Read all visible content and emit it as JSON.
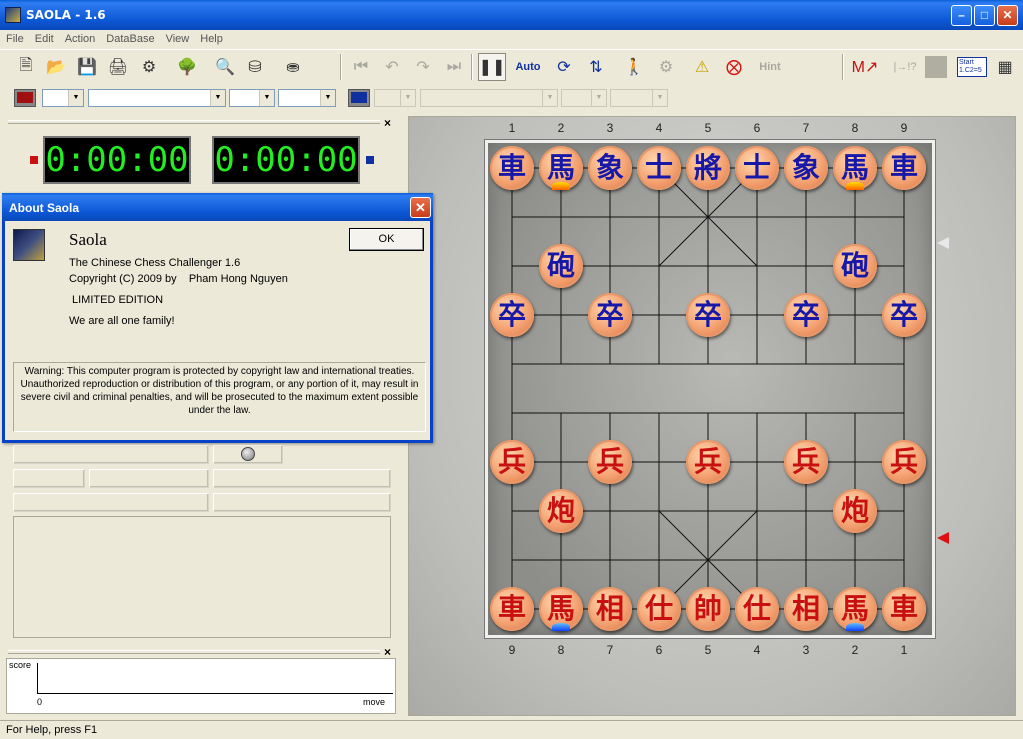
{
  "window": {
    "title": "SAOLA - 1.6"
  },
  "menu": [
    "File",
    "Edit",
    "Action",
    "DataBase",
    "View",
    "Help"
  ],
  "toolbar": {
    "auto_label": "Auto",
    "hint_label": "Hint",
    "start_label": "Start 1.C2=5"
  },
  "clocks": {
    "left": "0:00:00",
    "right": "0:00:00"
  },
  "graph": {
    "y_label": "score",
    "x_label": "move",
    "origin": "0"
  },
  "board": {
    "top_files": [
      "1",
      "2",
      "3",
      "4",
      "5",
      "6",
      "7",
      "8",
      "9"
    ],
    "bottom_files": [
      "9",
      "8",
      "7",
      "6",
      "5",
      "4",
      "3",
      "2",
      "1"
    ],
    "blue_back_rank": [
      "車",
      "馬",
      "象",
      "士",
      "將",
      "士",
      "象",
      "馬",
      "車"
    ],
    "blue_cannon": "砲",
    "blue_soldier": "卒",
    "red_back_rank": [
      "車",
      "馬",
      "相",
      "仕",
      "帥",
      "仕",
      "相",
      "馬",
      "車"
    ],
    "red_cannon": "炮",
    "red_soldier": "兵"
  },
  "about": {
    "title": "About Saola",
    "app_name": "Saola",
    "subtitle": "The Chinese Chess Challenger 1.6",
    "copyright": "Copyright (C) 2009 by    Pham Hong Nguyen",
    "edition": "LIMITED EDITION",
    "motto": "We are all one family!",
    "ok_label": "OK",
    "warning": "Warning: This computer program is protected by copyright law and international treaties. Unauthorized reproduction or distribution of this program, or any portion of it, may result in severe civil and criminal penalties, and will be prosecuted to the maximum extent possible under the law."
  },
  "status": {
    "text": "For Help, press F1"
  },
  "colors": {
    "red_side": "#c81010",
    "blue_side": "#1818a8",
    "clock_digits": "#22ee22"
  }
}
